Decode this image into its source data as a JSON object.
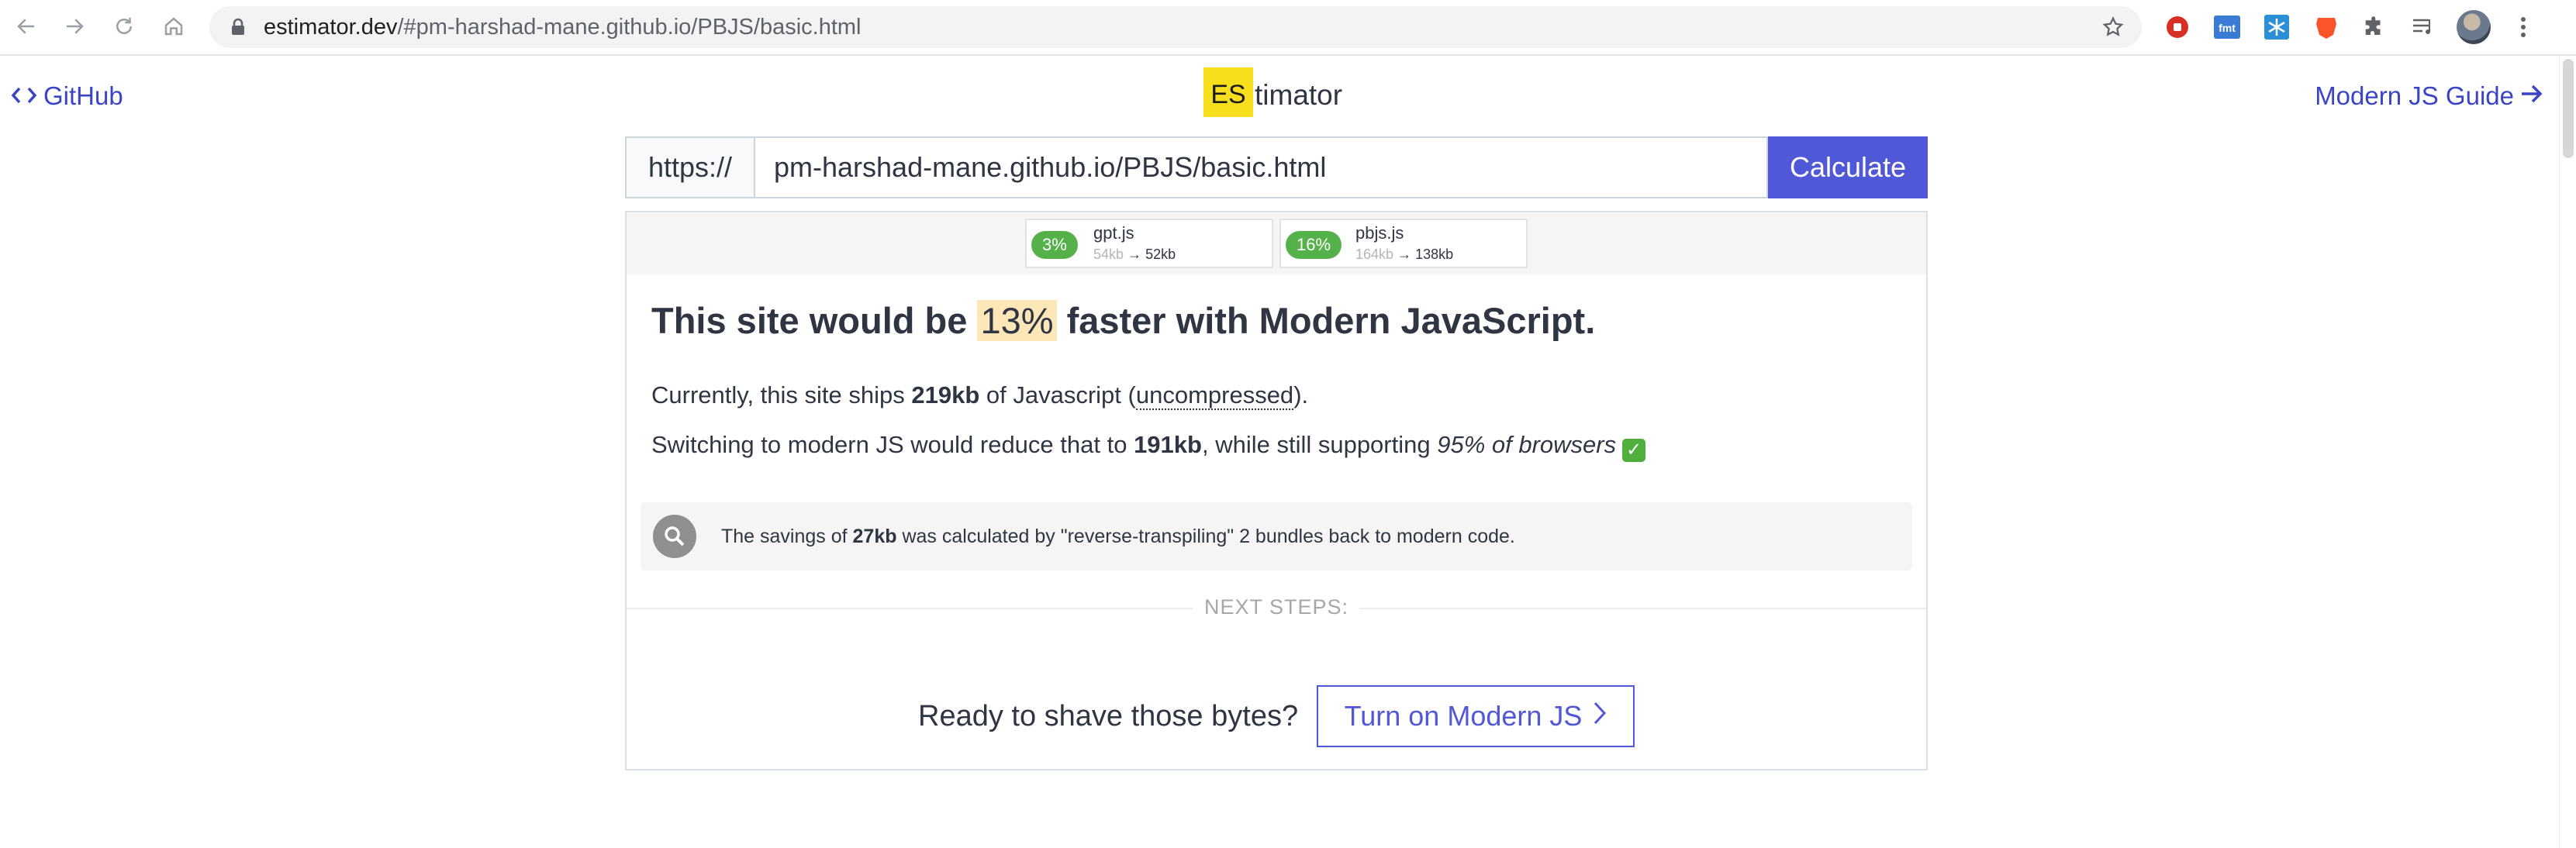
{
  "browser": {
    "url_host": "estimator.dev",
    "url_path": "/#pm-harshad-mane.github.io/PBJS/basic.html",
    "icons": [
      "back-icon",
      "forward-icon",
      "reload-icon",
      "home-icon",
      "lock-icon",
      "star-icon",
      "extensions-icon",
      "reading-list-icon",
      "more-icon"
    ]
  },
  "header": {
    "github_label": "GitHub",
    "logo_es": "ES",
    "logo_rest": "timator",
    "guide_label": "Modern JS Guide"
  },
  "form": {
    "prefix": "https://",
    "url_value": "pm-harshad-mane.github.io/PBJS/basic.html",
    "calculate_label": "Calculate"
  },
  "bundles": [
    {
      "pct": "3%",
      "name": "gpt.js",
      "old_size": "54kb",
      "arrow": "→",
      "new_size": "52kb"
    },
    {
      "pct": "16%",
      "name": "pbjs.js",
      "old_size": "164kb",
      "arrow": "→",
      "new_size": "138kb"
    }
  ],
  "result": {
    "headline_pre": "This site would be ",
    "headline_pct": "13%",
    "headline_post": " faster with Modern JavaScript.",
    "line1_pre": "Currently, this site ships ",
    "line1_size": "219kb",
    "line1_mid": " of Javascript (",
    "line1_uncompressed": "uncompressed",
    "line1_post": ").",
    "line2_pre": "Switching to modern JS would reduce that to ",
    "line2_size": "191kb",
    "line2_mid": ", while still supporting ",
    "line2_browsers": "95% of browsers",
    "line2_check": "✓"
  },
  "note": {
    "pre": "The savings of ",
    "size": "27kb",
    "post": " was calculated by \"reverse-transpiling\" 2 bundles back to modern code."
  },
  "next_steps": {
    "label": "NEXT STEPS:",
    "cta_text": "Ready to shave those bytes?",
    "cta_button": "Turn on Modern JS"
  },
  "colors": {
    "accent": "#5158d8",
    "link": "#3b44c6",
    "badge_green": "#55b24a",
    "highlight": "#fde6b8",
    "logo_yellow": "#f7df1e"
  }
}
